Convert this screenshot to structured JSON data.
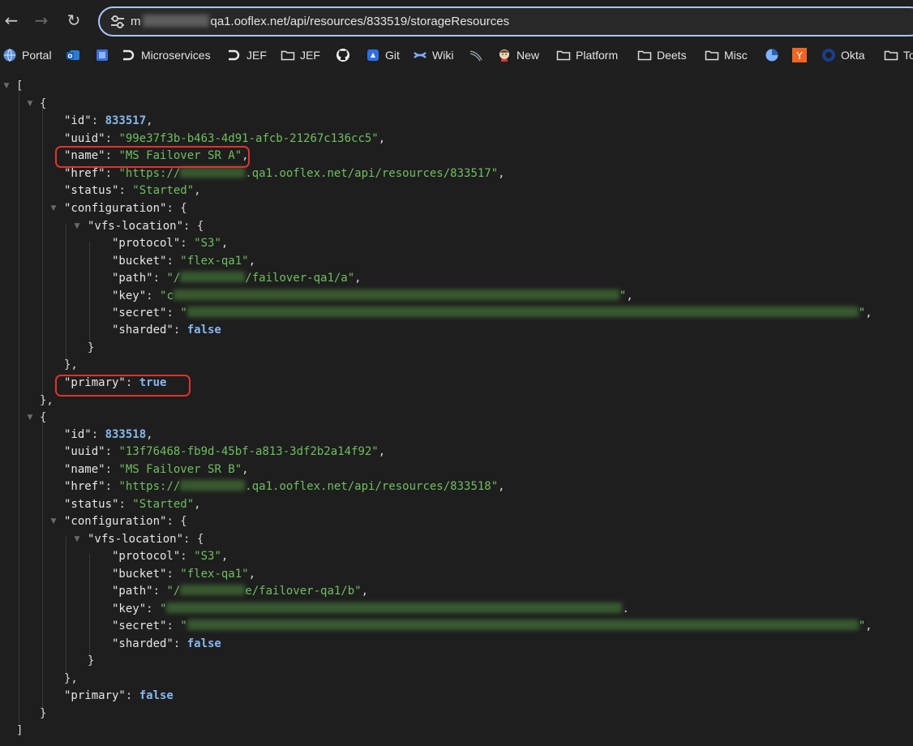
{
  "browser": {
    "url_prefix": "m",
    "url_suffix": "qa1.ooflex.net/api/resources/833519/storageResources"
  },
  "bookmarks": [
    {
      "label": "Portal",
      "icon": "globe-icon"
    },
    {
      "label": "",
      "icon": "outlook-icon"
    },
    {
      "label": "",
      "icon": "app-icon"
    },
    {
      "label": "Microservices",
      "icon": "ooflex-logo-icon"
    },
    {
      "label": "JEF",
      "icon": "ooflex-logo-icon"
    },
    {
      "label": "JEF",
      "icon": "folder-icon"
    },
    {
      "label": "",
      "icon": "github-icon"
    },
    {
      "label": "Git",
      "icon": "gitlab-icon"
    },
    {
      "label": "Wiki",
      "icon": "confluence-icon"
    },
    {
      "label": "",
      "icon": "swoosh-icon"
    },
    {
      "label": "New",
      "icon": "jenkins-icon"
    },
    {
      "label": "Platform",
      "icon": "folder-icon"
    },
    {
      "label": "Deets",
      "icon": "folder-icon"
    },
    {
      "label": "Misc",
      "icon": "folder-icon"
    },
    {
      "label": "",
      "icon": "pie-icon"
    },
    {
      "label": "",
      "icon": "y-combinator-icon"
    },
    {
      "label": "Okta",
      "icon": "okta-icon"
    },
    {
      "label": "To",
      "icon": "folder-icon"
    }
  ],
  "json": {
    "open_bracket": "[",
    "close_bracket": "]",
    "items": [
      {
        "id": "833517",
        "uuid": "\"99e37f3b-b463-4d91-afcb-21267c136cc5\"",
        "name": "\"MS Failover SR A\"",
        "href_prefix": "\"https://",
        "href_suffix": ".qa1.ooflex.net/api/resources/833517\"",
        "status": "\"Started\"",
        "protocol": "\"S3\"",
        "bucket": "\"flex-qa1\"",
        "path_prefix": "\"/",
        "path_suffix": "/failover-qa1/a\"",
        "key_prefix": "\"c",
        "key_suffix": "\"",
        "secret_prefix": "\"",
        "secret_suffix": "\"",
        "sharded": "false",
        "primary": "true"
      },
      {
        "id": "833518",
        "uuid": "\"13f76468-fb9d-45bf-a813-3df2b2a14f92\"",
        "name": "\"MS Failover SR B\"",
        "href_prefix": "\"https://",
        "href_suffix": ".qa1.ooflex.net/api/resources/833518\"",
        "status": "\"Started\"",
        "protocol": "\"S3\"",
        "bucket": "\"flex-qa1\"",
        "path_prefix": "\"/",
        "path_suffix": "e/failover-qa1/b\"",
        "key_prefix": "\"",
        "key_suffix": "",
        "secret_prefix": "\"",
        "secret_suffix": "\"",
        "sharded": "false",
        "primary": "false"
      }
    ]
  },
  "colors": {
    "highlight": "#e0322b",
    "string": "#6fbf5f",
    "number": "#86b7f0"
  }
}
